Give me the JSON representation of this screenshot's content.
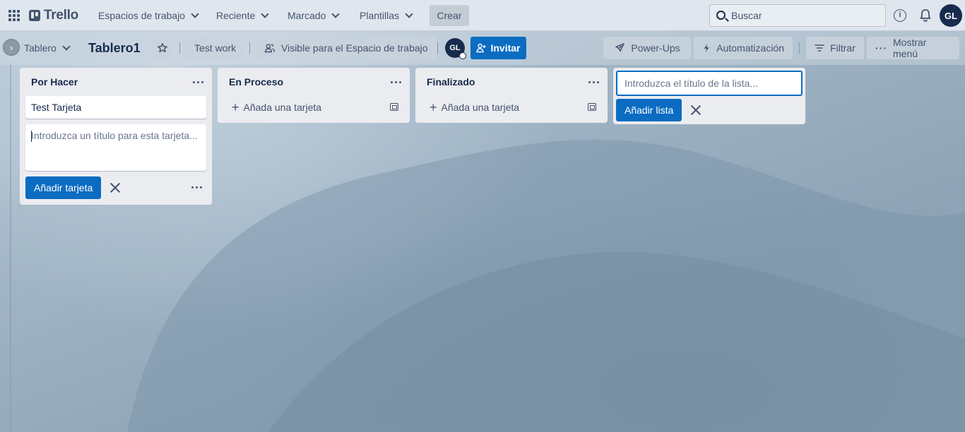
{
  "topbar": {
    "logo": "Trello",
    "nav": [
      {
        "label": "Espacios de trabajo"
      },
      {
        "label": "Reciente"
      },
      {
        "label": "Marcado"
      },
      {
        "label": "Plantillas"
      }
    ],
    "create_label": "Crear",
    "search_placeholder": "Buscar",
    "user_initials": "GL"
  },
  "boardbar": {
    "view_label": "Tablero",
    "board_title": "Tablero1",
    "workspace_label": "Test work",
    "visibility_label": "Visible para el Espacio de trabajo",
    "member_initials": "GL",
    "invite_label": "Invitar",
    "powerups_label": "Power-Ups",
    "automation_label": "Automatización",
    "filter_label": "Filtrar",
    "menu_label": "Mostrar menú"
  },
  "lists": [
    {
      "title": "Por Hacer",
      "cards": [
        "Test Tarjeta"
      ],
      "composer_placeholder": "Introduzca un título para esta tarjeta...",
      "add_button": "Añadir tarjeta"
    },
    {
      "title": "En Proceso",
      "add_card_label": "Añada una tarjeta"
    },
    {
      "title": "Finalizado",
      "add_card_label": "Añada una tarjeta"
    }
  ],
  "new_list": {
    "placeholder": "Introduzca el título de la lista...",
    "add_button": "Añadir lista"
  },
  "colors": {
    "primary": "#0b6cc2",
    "header_bg": "#dfe6ed",
    "list_bg": "#ebecf0",
    "avatar": "#172b4d"
  }
}
